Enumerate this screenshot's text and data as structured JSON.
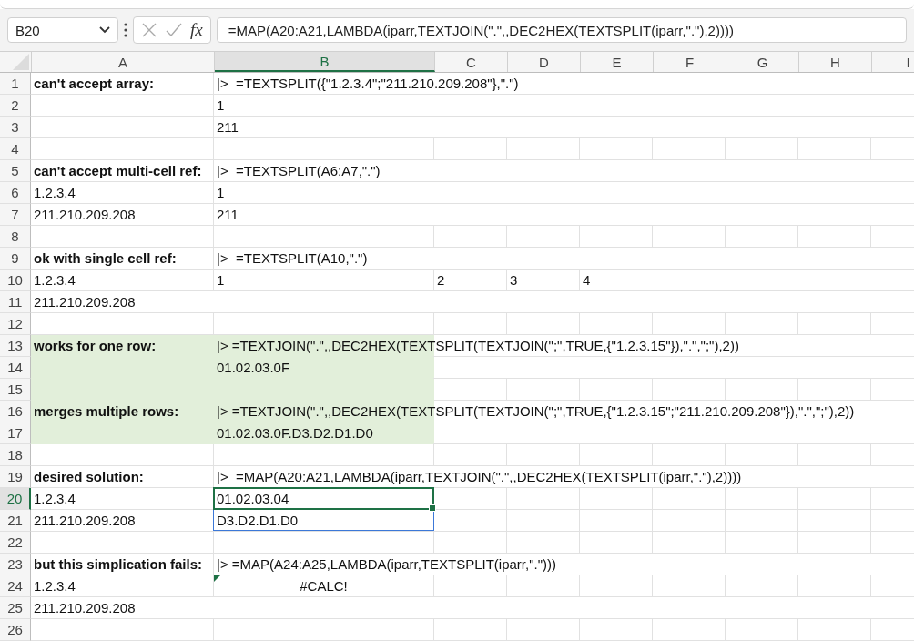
{
  "name_box": {
    "value": "B20"
  },
  "formula_bar": {
    "function_label": "fx",
    "formula": "=MAP(A20:A21,LAMBDA(iparr,TEXTJOIN(\".\",,DEC2HEX(TEXTSPLIT(iparr,\".\"),2))))"
  },
  "columns": [
    {
      "label": "A",
      "selected": false
    },
    {
      "label": "B",
      "selected": true
    },
    {
      "label": "C",
      "selected": false
    },
    {
      "label": "D",
      "selected": false
    },
    {
      "label": "E",
      "selected": false
    },
    {
      "label": "F",
      "selected": false
    },
    {
      "label": "G",
      "selected": false
    },
    {
      "label": "H",
      "selected": false
    },
    {
      "label": "I",
      "selected": false
    }
  ],
  "rows": [
    {
      "label": "1",
      "selected": false,
      "cells": [
        {
          "text": "can't accept array:",
          "bold": true
        },
        {
          "text": "|>  =TEXTSPLIT({\"1.2.3.4\";\"211.210.209.208\"},\".\")"
        }
      ]
    },
    {
      "label": "2",
      "selected": false,
      "cells": [
        {},
        {
          "text": "1"
        }
      ]
    },
    {
      "label": "3",
      "selected": false,
      "cells": [
        {},
        {
          "text": "211"
        }
      ]
    },
    {
      "label": "4",
      "selected": false,
      "cells": []
    },
    {
      "label": "5",
      "selected": false,
      "cells": [
        {
          "text": "can't accept multi-cell ref:",
          "bold": true
        },
        {
          "text": "|>  =TEXTSPLIT(A6:A7,\".\")"
        }
      ]
    },
    {
      "label": "6",
      "selected": false,
      "cells": [
        {
          "text": "1.2.3.4"
        },
        {
          "text": "1"
        }
      ]
    },
    {
      "label": "7",
      "selected": false,
      "cells": [
        {
          "text": "211.210.209.208"
        },
        {
          "text": "211"
        }
      ]
    },
    {
      "label": "8",
      "selected": false,
      "cells": []
    },
    {
      "label": "9",
      "selected": false,
      "cells": [
        {
          "text": "ok with single cell ref:",
          "bold": true
        },
        {
          "text": "|>  =TEXTSPLIT(A10,\".\")"
        }
      ]
    },
    {
      "label": "10",
      "selected": false,
      "cells": [
        {
          "text": "1.2.3.4"
        },
        {
          "text": "1"
        },
        {
          "text": "2"
        },
        {
          "text": "3"
        },
        {
          "text": "4"
        }
      ]
    },
    {
      "label": "11",
      "selected": false,
      "cells": [
        {
          "text": "211.210.209.208"
        }
      ]
    },
    {
      "label": "12",
      "selected": false,
      "cells": []
    },
    {
      "label": "13",
      "selected": false,
      "cells": [
        {
          "text": "works for one row:",
          "bold": true,
          "shaded": true
        },
        {
          "text": "|> =TEXTJOIN(\".\",,DEC2HEX(TEXTSPLIT(TEXTJOIN(\";\",TRUE,{\"1.2.3.15\"}),\".\",\";\"),2))",
          "shaded": true
        }
      ]
    },
    {
      "label": "14",
      "selected": false,
      "cells": [
        {
          "shaded": true
        },
        {
          "text": "01.02.03.0F",
          "shaded": true
        }
      ]
    },
    {
      "label": "15",
      "selected": false,
      "cells": [
        {
          "shaded": true
        },
        {
          "shaded": true
        }
      ]
    },
    {
      "label": "16",
      "selected": false,
      "cells": [
        {
          "text": "merges multiple rows:",
          "bold": true,
          "shaded": true
        },
        {
          "text": "|> =TEXTJOIN(\".\",,DEC2HEX(TEXTSPLIT(TEXTJOIN(\";\",TRUE,{\"1.2.3.15\";\"211.210.209.208\"}),\".\",\";\"),2))",
          "shaded": true
        }
      ]
    },
    {
      "label": "17",
      "selected": false,
      "cells": [
        {
          "shaded": true
        },
        {
          "text": "01.02.03.0F.D3.D2.D1.D0",
          "shaded": true
        }
      ]
    },
    {
      "label": "18",
      "selected": false,
      "cells": []
    },
    {
      "label": "19",
      "selected": false,
      "cells": [
        {
          "text": "desired solution:",
          "bold": true
        },
        {
          "text": "|>  =MAP(A20:A21,LAMBDA(iparr,TEXTJOIN(\".\",,DEC2HEX(TEXTSPLIT(iparr,\".\"),2))))"
        }
      ]
    },
    {
      "label": "20",
      "selected": true,
      "cells": [
        {
          "text": "1.2.3.4",
          "selected": false
        },
        {
          "text": "01.02.03.04",
          "selected": true
        }
      ]
    },
    {
      "label": "21",
      "selected": false,
      "cells": [
        {
          "text": "211.210.209.208",
          "selected": false
        },
        {
          "text": "D3.D2.D1.D0",
          "selected": false,
          "spill": true
        }
      ]
    },
    {
      "label": "22",
      "selected": false,
      "cells": []
    },
    {
      "label": "23",
      "selected": false,
      "cells": [
        {
          "text": "but this simplication fails:",
          "bold": true
        },
        {
          "text": "|> =MAP(A24:A25,LAMBDA(iparr,TEXTSPLIT(iparr,\".\")))"
        }
      ]
    },
    {
      "label": "24",
      "selected": false,
      "cells": [
        {
          "text": "1.2.3.4"
        },
        {
          "text": "#CALC!",
          "error_flag": true
        }
      ]
    },
    {
      "label": "25",
      "selected": false,
      "cells": [
        {
          "text": "211.210.209.208"
        }
      ]
    },
    {
      "label": "26",
      "selected": false,
      "cells": []
    }
  ]
}
